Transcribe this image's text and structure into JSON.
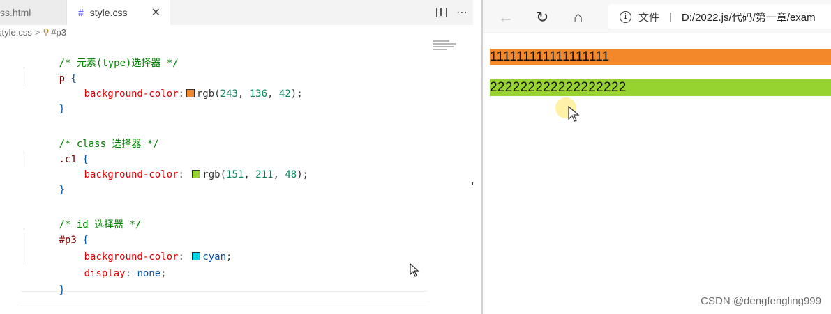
{
  "editor": {
    "tabs": [
      {
        "label": "ss.html",
        "active": false
      },
      {
        "label": "style.css",
        "active": true,
        "icon": "#"
      }
    ],
    "tab_close": "✕",
    "breadcrumb": {
      "file": "style.css",
      "separator": ">",
      "symbol_icon": "selector-icon",
      "symbol": "#p3"
    },
    "code": {
      "l1_comment": "/* 元素(type)选择器 */",
      "l2_sel": "p",
      "l3_prop": "background-color",
      "l3_swatch": "#f3882a",
      "l3_fn": "rgb(",
      "l3_n1": "243",
      "l3_n2": "136",
      "l3_n3": "42",
      "l5_comment": "/* class 选择器 */",
      "l6_sel": ".c1",
      "l7_prop": "background-color",
      "l7_swatch": "#97d330",
      "l7_fn": "rgb(",
      "l7_n1": "151",
      "l7_n2": "211",
      "l7_n3": "48",
      "l9_comment": "/* id 选择器 */",
      "l10_sel": "#p3",
      "l11_prop": "background-color",
      "l11_swatch": "#00ffff",
      "l11_val": "cyan",
      "l12_prop": "display",
      "l12_val": "none",
      "open_brace": "{",
      "close_brace": "}"
    }
  },
  "browser": {
    "info_icon": "i",
    "file_label": "文件",
    "address_sep": "|",
    "url": "D:/2022.js/代码/第一章/exam",
    "paragraphs": [
      {
        "text": "111111111111111111",
        "bg": "#f3882a"
      },
      {
        "text": "222222222222222222",
        "bg": "#97d330"
      }
    ]
  },
  "watermark": "CSDN @dengfengling999"
}
